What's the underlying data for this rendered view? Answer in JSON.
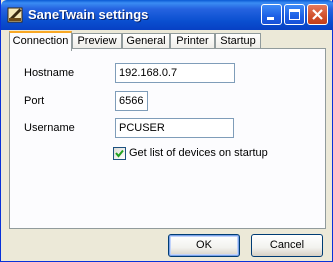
{
  "window": {
    "title": "SaneTwain settings",
    "icon": "scanner-icon",
    "controls": [
      "minimize-icon",
      "maximize-icon",
      "close-icon"
    ]
  },
  "tabs": [
    {
      "label": "Connection",
      "active": true
    },
    {
      "label": "Preview",
      "active": false
    },
    {
      "label": "General",
      "active": false
    },
    {
      "label": "Printer",
      "active": false
    },
    {
      "label": "Startup",
      "active": false
    }
  ],
  "connection": {
    "hostname_label": "Hostname",
    "hostname_value": "192.168.0.7",
    "port_label": "Port",
    "port_value": "6566",
    "username_label": "Username",
    "username_value": "PCUSER",
    "startup_checkbox_label": "Get list of devices on startup",
    "startup_checkbox_checked": true
  },
  "buttons": {
    "ok": "OK",
    "cancel": "Cancel"
  }
}
